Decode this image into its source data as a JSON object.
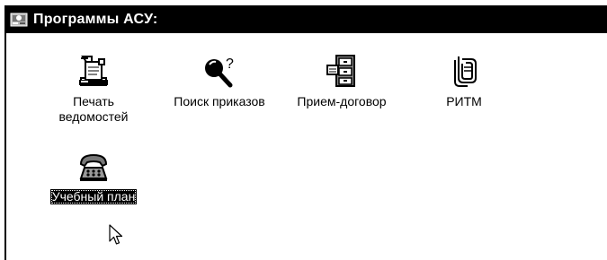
{
  "window": {
    "title": "Программы АСУ:"
  },
  "icons": [
    {
      "label": "Печать\nведомостей",
      "icon": "printer-report-icon"
    },
    {
      "label": "Поиск приказов",
      "icon": "magnifier-question-icon"
    },
    {
      "label": "Прием-договор",
      "icon": "file-cabinet-icon"
    },
    {
      "label": "РИТМ",
      "icon": "paper-clip-icon"
    },
    {
      "label": "Учебный план",
      "icon": "telephone-icon",
      "selected": true
    }
  ]
}
